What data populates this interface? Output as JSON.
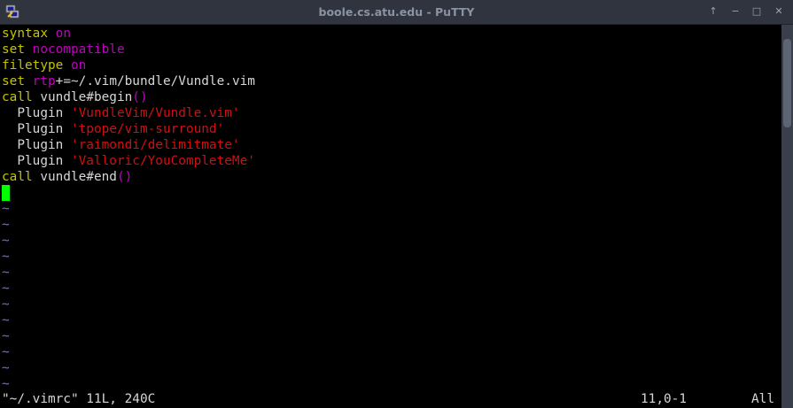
{
  "window": {
    "title": "boole.cs.atu.edu - PuTTY",
    "controls": {
      "menu": "↑",
      "minimize": "−",
      "maximize": "□",
      "close": "✕"
    },
    "app_icon": "putty-icon"
  },
  "editor": {
    "lines": [
      [
        {
          "t": "syntax",
          "c": "kw"
        },
        {
          "t": " ",
          "c": "plain"
        },
        {
          "t": "on",
          "c": "val"
        }
      ],
      [
        {
          "t": "set",
          "c": "kw"
        },
        {
          "t": " ",
          "c": "plain"
        },
        {
          "t": "nocompatible",
          "c": "val"
        }
      ],
      [
        {
          "t": "filetype",
          "c": "kw"
        },
        {
          "t": " ",
          "c": "plain"
        },
        {
          "t": "on",
          "c": "val"
        }
      ],
      [
        {
          "t": "set",
          "c": "kw"
        },
        {
          "t": " ",
          "c": "plain"
        },
        {
          "t": "rtp",
          "c": "val"
        },
        {
          "t": "+=~/.vim/bundle/Vundle.vim",
          "c": "plain"
        }
      ],
      [
        {
          "t": "call",
          "c": "kw"
        },
        {
          "t": " vundle#begin",
          "c": "plain"
        },
        {
          "t": "()",
          "c": "val"
        }
      ],
      [
        {
          "t": "  Plugin ",
          "c": "plain"
        },
        {
          "t": "'VundleVim/Vundle.vim'",
          "c": "str"
        }
      ],
      [
        {
          "t": "  Plugin ",
          "c": "plain"
        },
        {
          "t": "'tpope/vim-surround'",
          "c": "str"
        }
      ],
      [
        {
          "t": "  Plugin ",
          "c": "plain"
        },
        {
          "t": "'raimondi/delimitmate'",
          "c": "str"
        }
      ],
      [
        {
          "t": "  Plugin ",
          "c": "plain"
        },
        {
          "t": "'Valloric/YouCompleteMe'",
          "c": "str"
        }
      ],
      [
        {
          "t": "call",
          "c": "kw"
        },
        {
          "t": " vundle#end",
          "c": "plain"
        },
        {
          "t": "()",
          "c": "val"
        }
      ]
    ],
    "empty_line_marker": "~",
    "empty_line_count": 12,
    "cursor_line": 11
  },
  "statusline": {
    "file_info": "\"~/.vimrc\" 11L, 240C",
    "position": "11,0-1",
    "scroll": "All"
  },
  "colors": {
    "keyword": "#c4c400",
    "value": "#c000c0",
    "string": "#d01010",
    "text": "#d6d6d6",
    "tilde": "#6c6cff",
    "cursor": "#00ff00",
    "titlebar": "#2f343f"
  }
}
